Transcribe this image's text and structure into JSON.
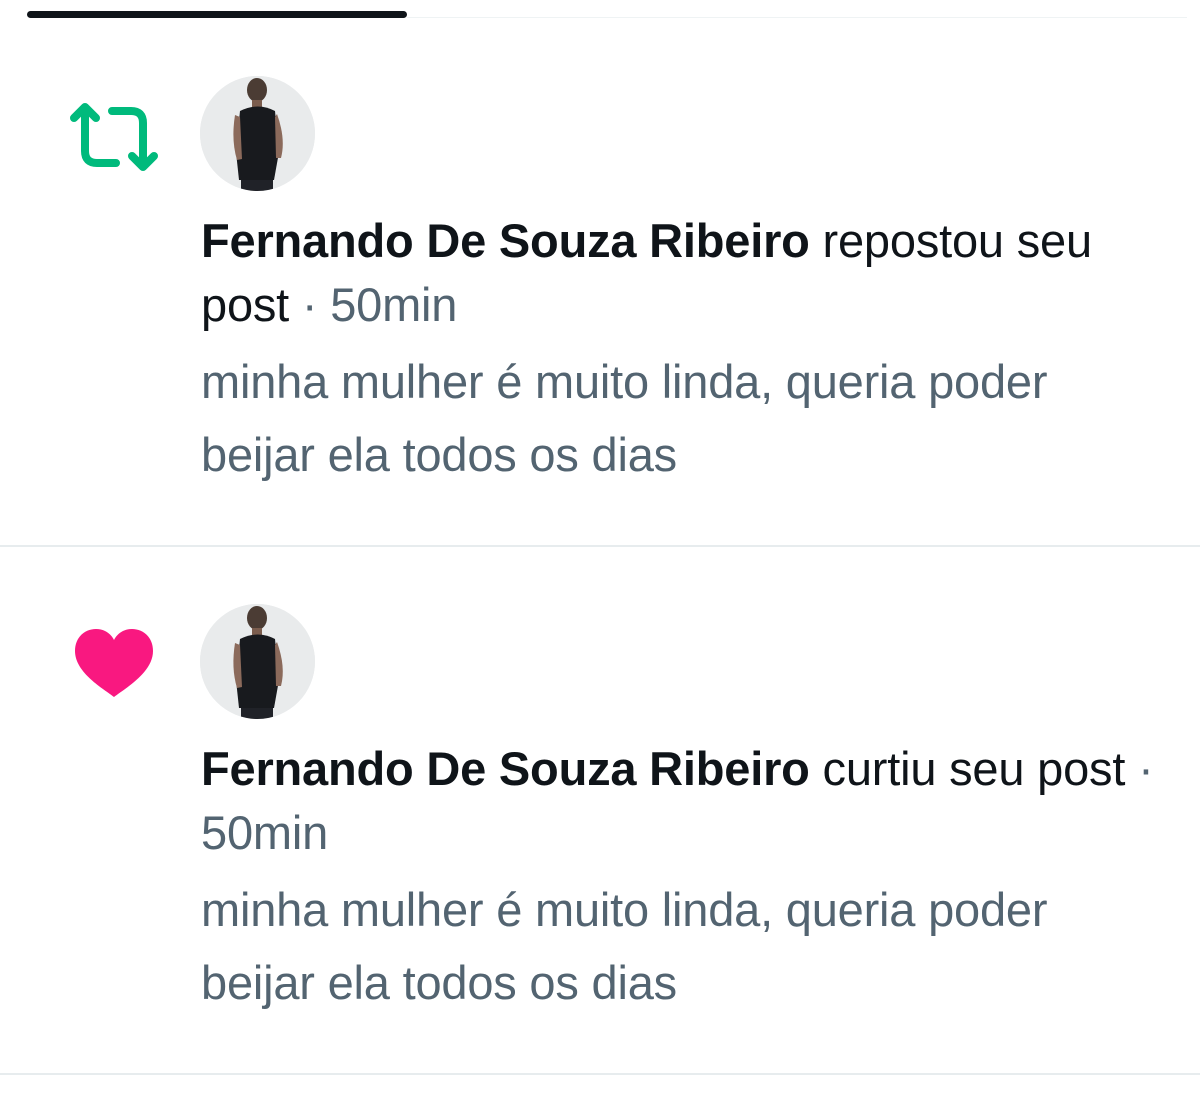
{
  "notifications": [
    {
      "type": "repost",
      "icon": "repost-icon",
      "icon_color": "#00ba7c",
      "user_name": "Fernando De Souza Ribeiro",
      "action": "repostou seu post",
      "separator": "·",
      "time": "50min",
      "post_text": "minha mulher é muito linda, queria poder beijar ela todos os dias"
    },
    {
      "type": "like",
      "icon": "heart-icon",
      "icon_color": "#f91880",
      "user_name": "Fernando De Souza Ribeiro",
      "action": "curtiu seu post",
      "separator": "·",
      "time": "50min",
      "post_text": "minha mulher é muito linda, queria poder beijar ela todos os dias"
    }
  ]
}
